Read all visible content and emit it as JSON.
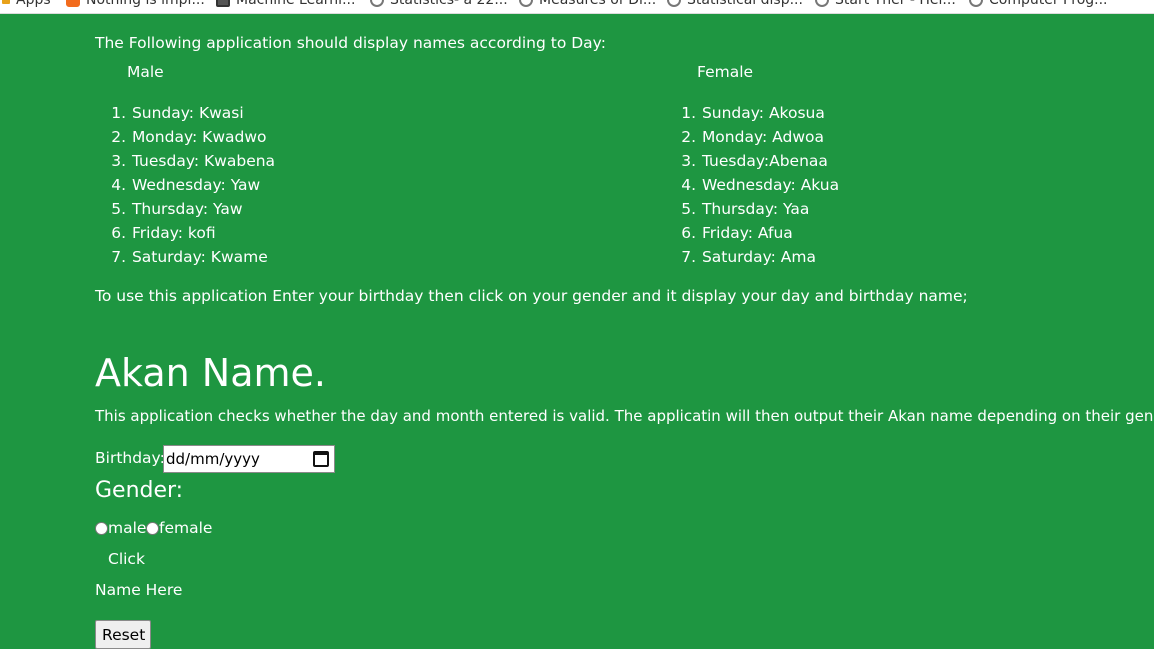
{
  "bookmarks": [
    {
      "label": "Apps",
      "icon": "apps-icon"
    },
    {
      "label": "Nothing is impl...",
      "icon": "blogger-icon"
    },
    {
      "label": "Machine Learni...",
      "icon": "page-icon"
    },
    {
      "label": "Statistics- a 22...",
      "icon": "globe-icon"
    },
    {
      "label": "Measures of Di...",
      "icon": "globe-icon"
    },
    {
      "label": "Statistical disp...",
      "icon": "globe-icon"
    },
    {
      "label": "Start Ther - Hel...",
      "icon": "globe-icon"
    },
    {
      "label": "Computer Prog...",
      "icon": "globe-icon"
    }
  ],
  "intro": "The Following application should display names according to Day:",
  "male": {
    "heading": "Male",
    "items": [
      {
        "n": "1.",
        "text": "Sunday: Kwasi"
      },
      {
        "n": "2.",
        "text": "Monday: Kwadwo"
      },
      {
        "n": "3.",
        "text": "Tuesday: Kwabena"
      },
      {
        "n": "4.",
        "text": "Wednesday: Yaw"
      },
      {
        "n": "5.",
        "text": "Thursday: Yaw"
      },
      {
        "n": "6.",
        "text": "Friday: kofi"
      },
      {
        "n": "7.",
        "text": "Saturday: Kwame"
      }
    ]
  },
  "female": {
    "heading": "Female",
    "items": [
      {
        "n": "1.",
        "text": "Sunday: Akosua"
      },
      {
        "n": "2.",
        "text": "Monday: Adwoa"
      },
      {
        "n": "3.",
        "text": "Tuesday:Abenaa"
      },
      {
        "n": "4.",
        "text": "Wednesday: Akua"
      },
      {
        "n": "5.",
        "text": "Thursday: Yaa"
      },
      {
        "n": "6.",
        "text": "Friday: Afua"
      },
      {
        "n": "7.",
        "text": "Saturday: Ama"
      }
    ]
  },
  "instructions": "To use this application Enter your birthday then click on your gender and it display your day and birthday name;",
  "title": "Akan Name.",
  "description": "This application checks whether the day and month entered is valid. The applicatin will then output their Akan name depending on their gender.",
  "form": {
    "birthday_label": "Birthday:",
    "birthday_placeholder": "dd/mm/yyyy",
    "gender_label": "Gender:",
    "male_label": "male",
    "female_label": "female",
    "click_label": "Click",
    "name_output": "Name Here",
    "reset_label": "Reset"
  },
  "colors": {
    "background": "#1e9641",
    "text": "#ffffff"
  }
}
